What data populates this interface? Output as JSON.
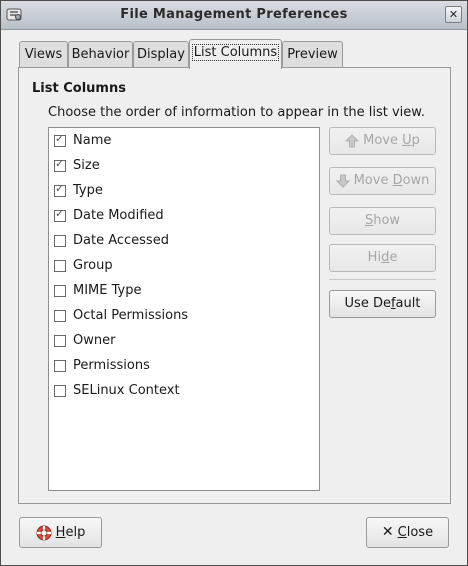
{
  "window": {
    "title": "File Management Preferences"
  },
  "tabs": [
    {
      "label": "Views"
    },
    {
      "label": "Behavior"
    },
    {
      "label": "Display"
    },
    {
      "label": "List Columns"
    },
    {
      "label": "Preview"
    }
  ],
  "list_columns": {
    "heading": "List Columns",
    "description": "Choose the order of information to appear in the list view.",
    "items": [
      {
        "label": "Name",
        "checked": true
      },
      {
        "label": "Size",
        "checked": true
      },
      {
        "label": "Type",
        "checked": true
      },
      {
        "label": "Date Modified",
        "checked": true
      },
      {
        "label": "Date Accessed",
        "checked": false
      },
      {
        "label": "Group",
        "checked": false
      },
      {
        "label": "MIME Type",
        "checked": false
      },
      {
        "label": "Octal Permissions",
        "checked": false
      },
      {
        "label": "Owner",
        "checked": false
      },
      {
        "label": "Permissions",
        "checked": false
      },
      {
        "label": "SELinux Context",
        "checked": false
      }
    ]
  },
  "buttons": {
    "move_up": {
      "pre": "Move ",
      "mn": "U",
      "post": "p"
    },
    "move_down": {
      "pre": "Move ",
      "mn": "D",
      "post": "own"
    },
    "show": {
      "pre": "",
      "mn": "S",
      "post": "how"
    },
    "hide": {
      "pre": "Hi",
      "mn": "d",
      "post": "e"
    },
    "use_default": {
      "pre": "Use De",
      "mn": "f",
      "post": "ault"
    },
    "help": {
      "pre": "",
      "mn": "H",
      "post": "elp"
    },
    "close": {
      "pre": "",
      "mn": "C",
      "post": "lose"
    }
  },
  "colors": {
    "disabled_text": "#a6a6a6",
    "titlebar": "#c8ced5"
  }
}
